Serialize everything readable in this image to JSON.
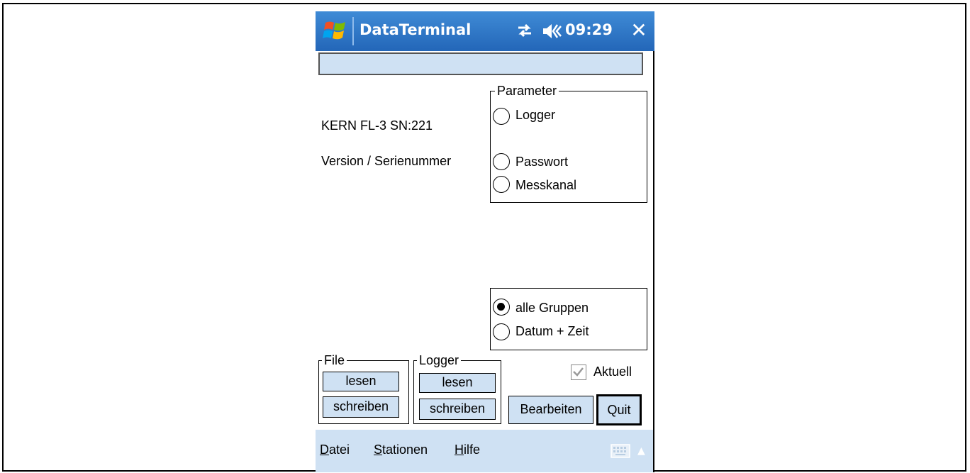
{
  "window": {
    "title": "DataTerminal",
    "clock": "09:29",
    "close_symbol": "✕"
  },
  "info": {
    "device_line": "KERN FL-3 SN:221",
    "version_line": "Version / Serienummer"
  },
  "parameter_group": {
    "title": "Parameter",
    "options": [
      {
        "label": "Logger",
        "selected": false
      },
      {
        "label": "Passwort",
        "selected": false
      },
      {
        "label": "Messkanal",
        "selected": false
      }
    ]
  },
  "scope_group": {
    "options": [
      {
        "label": "alle Gruppen",
        "selected": true
      },
      {
        "label": "Datum + Zeit",
        "selected": false
      }
    ]
  },
  "file_group": {
    "title": "File",
    "read_label": "lesen",
    "write_label": "schreiben"
  },
  "logger_group": {
    "title": "Logger",
    "read_label": "lesen",
    "write_label": "schreiben"
  },
  "aktuell": {
    "label": "Aktuell",
    "checked": true
  },
  "actions": {
    "edit_label": "Bearbeiten",
    "quit_label": "Quit"
  },
  "menu": {
    "items": [
      {
        "mnemonic": "D",
        "rest": "atei"
      },
      {
        "mnemonic": "S",
        "rest": "tationen"
      },
      {
        "mnemonic": "H",
        "rest": "ilfe"
      }
    ]
  },
  "icons": {
    "start": "windows-flag-icon",
    "connectivity": "connectivity-arrows-icon",
    "volume": "speaker-muted-icon",
    "keyboard": "keyboard-icon"
  },
  "colors": {
    "titlebar": "#2a6fc3",
    "button_face": "#cfe1f3",
    "menubar": "#cfe1f3"
  }
}
